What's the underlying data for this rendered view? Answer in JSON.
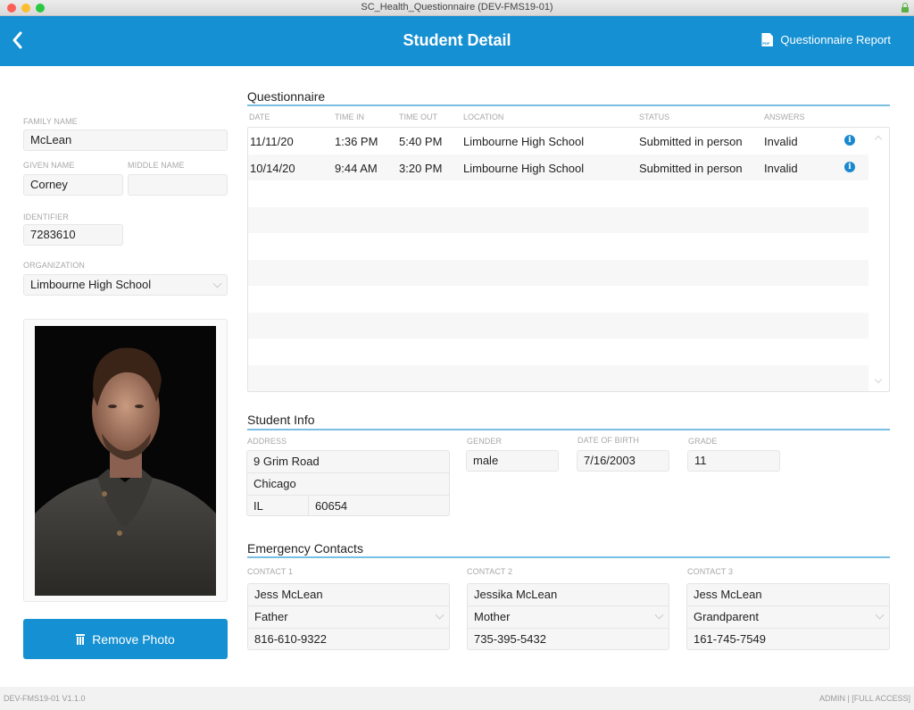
{
  "window": {
    "title": "SC_Health_Questionnaire (DEV-FMS19-01)"
  },
  "navbar": {
    "title": "Student Detail",
    "report_label": "Questionnaire Report",
    "back_icon": "chevron-left-icon",
    "report_icon": "pdf-icon"
  },
  "student": {
    "family_name_label": "FAMILY NAME",
    "family_name": "McLean",
    "given_name_label": "GIVEN NAME",
    "given_name": "Corney",
    "middle_name_label": "MIDDLE NAME",
    "middle_name": "",
    "identifier_label": "IDENTIFIER",
    "identifier": "7283610",
    "organization_label": "ORGANIZATION",
    "organization": "Limbourne High School",
    "remove_photo_label": "Remove Photo"
  },
  "questionnaire": {
    "title": "Questionnaire",
    "columns": [
      "DATE",
      "TIME IN",
      "TIME OUT",
      "LOCATION",
      "STATUS",
      "ANSWERS"
    ],
    "rows": [
      {
        "date": "11/11/20",
        "time_in": "1:36 PM",
        "time_out": "5:40 PM",
        "location": "Limbourne High School",
        "status": "Submitted in person",
        "answers": "Invalid",
        "icon": "i"
      },
      {
        "date": "10/14/20",
        "time_in": "9:44 AM",
        "time_out": "3:20 PM",
        "location": "Limbourne High School",
        "status": "Submitted in person",
        "answers": "Invalid",
        "icon": "i"
      }
    ]
  },
  "student_info": {
    "title": "Student Info",
    "address_label": "ADDRESS",
    "street": "9 Grim Road",
    "city": "Chicago",
    "state": "IL",
    "zip": "60654",
    "gender_label": "GENDER",
    "gender": "male",
    "dob_label": "DATE OF BIRTH",
    "dob": "7/16/2003",
    "grade_label": "GRADE",
    "grade": "11"
  },
  "emergency": {
    "title": "Emergency Contacts",
    "contacts": [
      {
        "label": "CONTACT 1",
        "name": "Jess McLean",
        "relation": "Father",
        "phone": "816-610-9322"
      },
      {
        "label": "CONTACT 2",
        "name": "Jessika McLean",
        "relation": "Mother",
        "phone": "735-395-5432"
      },
      {
        "label": "CONTACT 3",
        "name": "Jess McLean",
        "relation": "Grandparent",
        "phone": "161-745-7549"
      }
    ]
  },
  "footer": {
    "version": "DEV-FMS19-01 V1.1.0",
    "user": "ADMIN | [FULL ACCESS]"
  }
}
